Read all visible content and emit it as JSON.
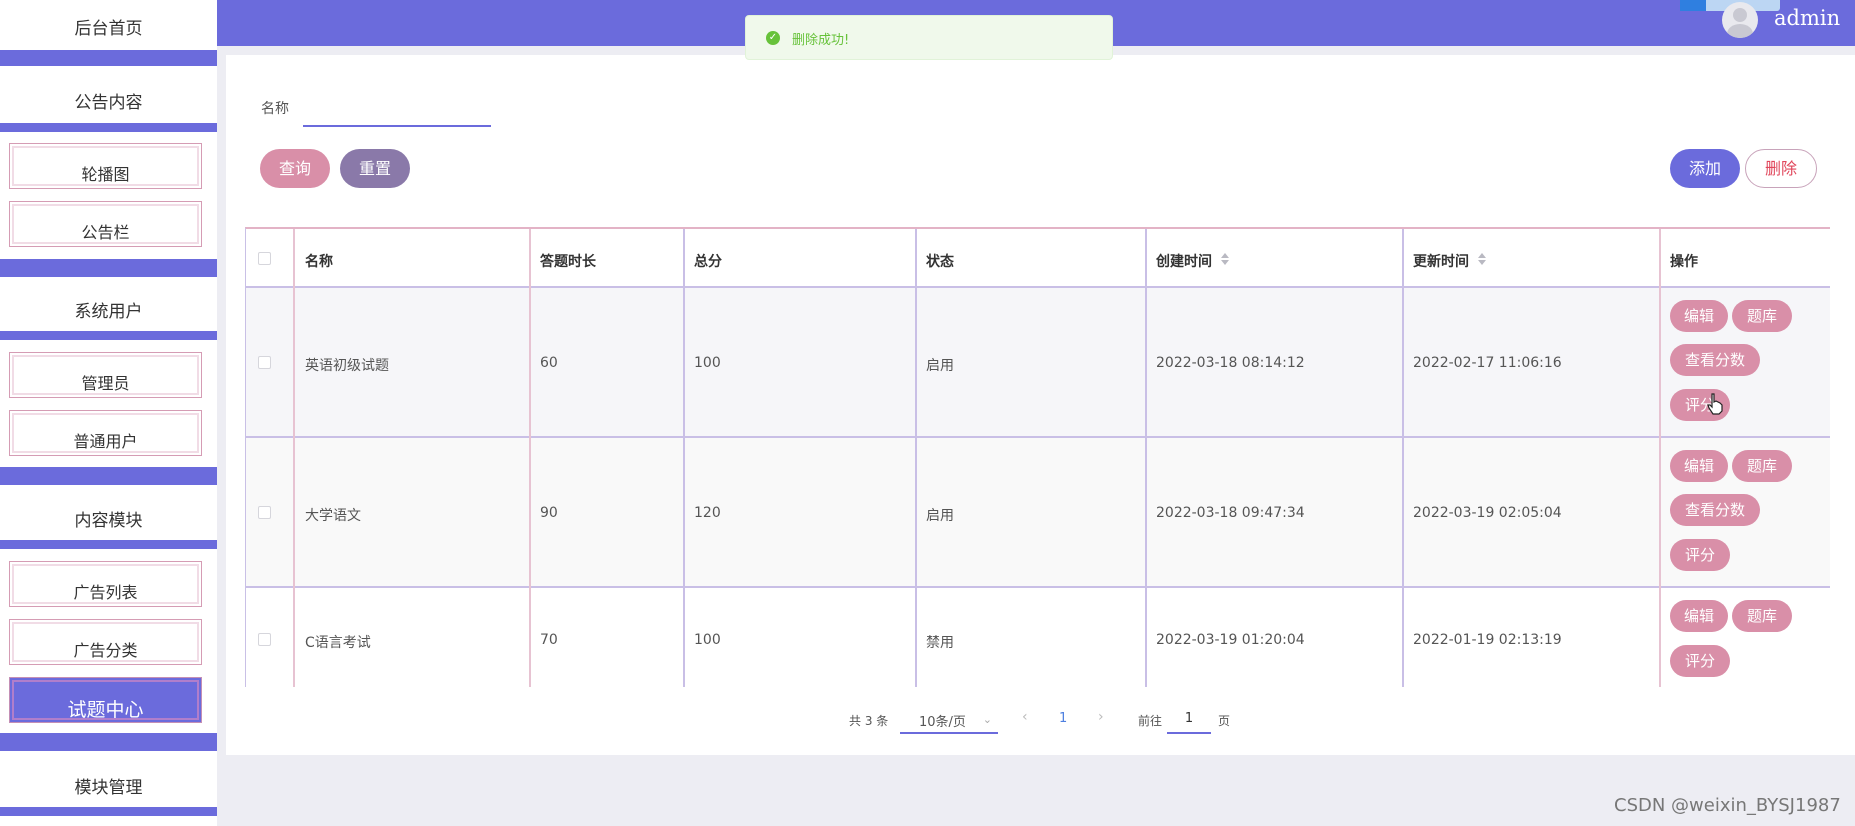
{
  "header": {
    "username": "admin"
  },
  "toast": {
    "message": "删除成功!"
  },
  "sidebar": {
    "items": [
      {
        "label": "后台首页",
        "type": "head"
      },
      {
        "label": "公告内容",
        "type": "head"
      },
      {
        "label": "轮播图",
        "type": "sub"
      },
      {
        "label": "公告栏",
        "type": "sub"
      },
      {
        "label": "系统用户",
        "type": "head"
      },
      {
        "label": "管理员",
        "type": "sub"
      },
      {
        "label": "普通用户",
        "type": "sub"
      },
      {
        "label": "内容模块",
        "type": "head"
      },
      {
        "label": "广告列表",
        "type": "sub"
      },
      {
        "label": "广告分类",
        "type": "sub"
      },
      {
        "label": "试题中心",
        "type": "sub",
        "active": true
      },
      {
        "label": "模块管理",
        "type": "head"
      }
    ]
  },
  "search": {
    "name_label": "名称",
    "name_value": "",
    "query_label": "查询",
    "reset_label": "重置"
  },
  "actions": {
    "add_label": "添加",
    "delete_label": "删除"
  },
  "table": {
    "columns": [
      "名称",
      "答题时长",
      "总分",
      "状态",
      "创建时间",
      "更新时间",
      "操作"
    ],
    "rows": [
      {
        "name": "英语初级试题",
        "duration": "60",
        "score": "100",
        "status": "启用",
        "created": "2022-03-18 08:14:12",
        "updated": "2022-02-17 11:06:16",
        "ops": [
          "编辑",
          "题库",
          "查看分数",
          "评分"
        ]
      },
      {
        "name": "大学语文",
        "duration": "90",
        "score": "120",
        "status": "启用",
        "created": "2022-03-18 09:47:34",
        "updated": "2022-03-19 02:05:04",
        "ops": [
          "编辑",
          "题库",
          "查看分数",
          "评分"
        ]
      },
      {
        "name": "C语言考试",
        "duration": "70",
        "score": "100",
        "status": "禁用",
        "created": "2022-03-19 01:20:04",
        "updated": "2022-01-19 02:13:19",
        "ops": [
          "编辑",
          "题库",
          "评分"
        ]
      }
    ]
  },
  "pagination": {
    "total_text": "共 3 条",
    "page_size": "10条/页",
    "current_page": "1",
    "goto_label": "前往",
    "goto_value": "1",
    "page_unit": "页"
  },
  "watermark": "CSDN @weixin_BYSJ1987",
  "colors": {
    "accent": "#6b6bdc",
    "pink": "#d98fa8",
    "mauve": "#8a79a9",
    "success": "#67c23a"
  }
}
